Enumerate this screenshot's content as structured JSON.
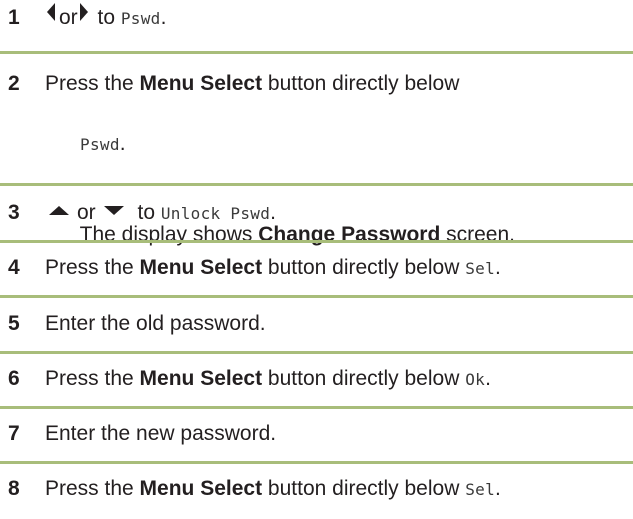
{
  "steps": [
    {
      "number": "1",
      "icon_left": "left-arrow-icon",
      "or": "or",
      "icon_right": "right-arrow-icon",
      "to": " to ",
      "target": "Pswd",
      "end": "."
    },
    {
      "number": "2",
      "pre": "Press the ",
      "bold": "Menu Select",
      "post": " button directly below",
      "line2_code": "Pswd",
      "line2_end": ".",
      "line3_pre": "The display shows ",
      "line3_bold": "Change Password",
      "line3_post": " screen."
    },
    {
      "number": "3",
      "icon_up": "up-arrow-icon",
      "or": "or",
      "icon_down": "down-arrow-icon",
      "to": " to ",
      "target": "Unlock Pswd",
      "end": "."
    },
    {
      "number": "4",
      "pre": "Press the ",
      "bold": "Menu Select",
      "post": " button directly below ",
      "code": "Sel",
      "end": "."
    },
    {
      "number": "5",
      "text": "Enter the old password."
    },
    {
      "number": "6",
      "pre": "Press the ",
      "bold": "Menu Select",
      "post": " button directly below ",
      "code": "Ok",
      "end": "."
    },
    {
      "number": "7",
      "text": "Enter the new password."
    },
    {
      "number": "8",
      "pre": "Press the ",
      "bold": "Menu Select",
      "post": " button directly below ",
      "code": "Sel",
      "end": "."
    }
  ],
  "colors": {
    "divider": "#a8bd7a",
    "text": "#231f20"
  }
}
